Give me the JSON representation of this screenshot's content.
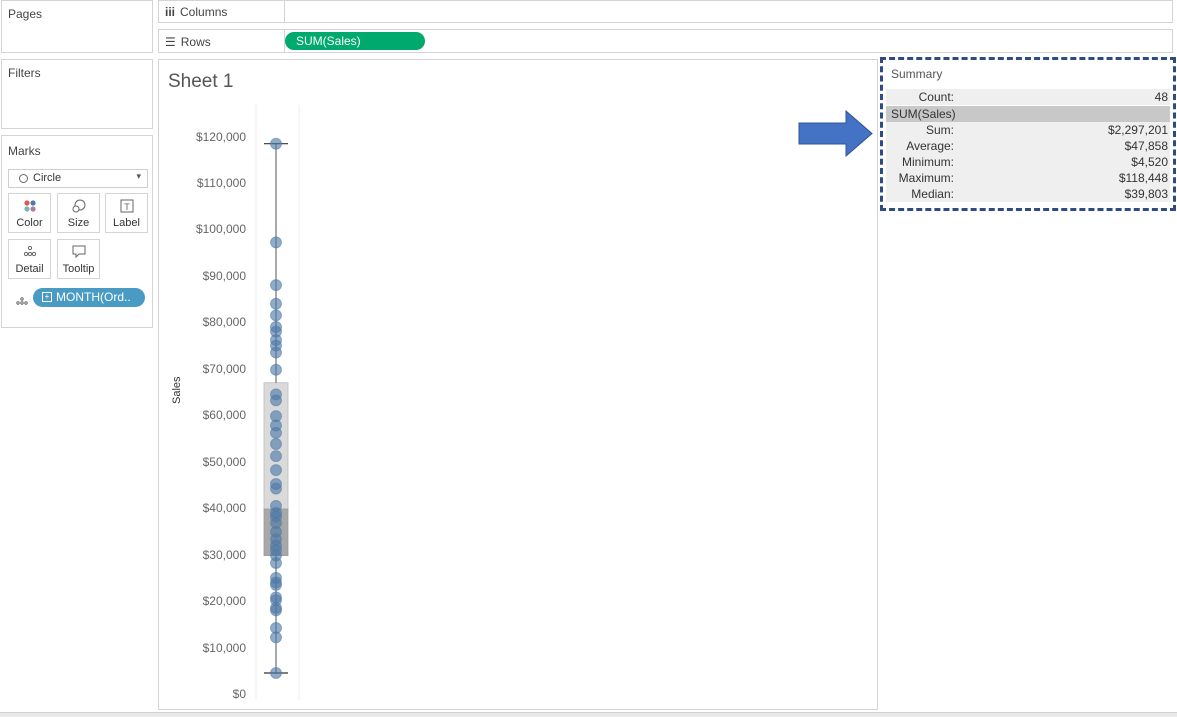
{
  "left_panel": {
    "pages_title": "Pages",
    "filters_title": "Filters",
    "marks_title": "Marks",
    "mark_type": "Circle",
    "buttons": [
      {
        "label": "Color",
        "icon": "color-icon"
      },
      {
        "label": "Size",
        "icon": "size-icon"
      },
      {
        "label": "Label",
        "icon": "label-icon"
      },
      {
        "label": "Detail",
        "icon": "detail-icon"
      },
      {
        "label": "Tooltip",
        "icon": "tooltip-icon"
      }
    ],
    "detail_pill": "MONTH(Ord.."
  },
  "shelves": {
    "columns_label": "Columns",
    "rows_label": "Rows",
    "rows_pill": "SUM(Sales)"
  },
  "sheet": {
    "title": "Sheet 1"
  },
  "chart_data": {
    "type": "scatter",
    "title": "Sheet 1",
    "ylabel": "Sales",
    "xlabel": "",
    "ylim": [
      0,
      125000
    ],
    "yticks": [
      "$0",
      "$10,000",
      "$20,000",
      "$30,000",
      "$40,000",
      "$50,000",
      "$60,000",
      "$70,000",
      "$80,000",
      "$90,000",
      "$100,000",
      "$110,000",
      "$120,000"
    ],
    "ytick_values": [
      0,
      10000,
      20000,
      30000,
      40000,
      50000,
      60000,
      70000,
      80000,
      90000,
      100000,
      110000,
      120000
    ],
    "box_plot": {
      "min": 4520,
      "q1": 29800,
      "median": 39803,
      "q3": 67000,
      "max": 118448
    },
    "values": [
      118448,
      97200,
      88000,
      84000,
      81500,
      79000,
      78000,
      76200,
      75000,
      73500,
      69800,
      64500,
      63200,
      59800,
      57800,
      56200,
      53800,
      51200,
      48200,
      45200,
      44200,
      40500,
      39000,
      38200,
      36800,
      34900,
      33300,
      32000,
      31000,
      29800,
      28200,
      25000,
      24000,
      23500,
      20800,
      20200,
      18500,
      18000,
      14200,
      12200,
      4520
    ],
    "grid": false,
    "color": "#4e79a7",
    "box_light": "#dadada",
    "box_dark": "#a8a8a8"
  },
  "summary": {
    "title": "Summary",
    "count_label": "Count:",
    "count_value": "48",
    "section": "SUM(Sales)",
    "rows": [
      {
        "label": "Sum:",
        "value": "$2,297,201"
      },
      {
        "label": "Average:",
        "value": "$47,858"
      },
      {
        "label": "Minimum:",
        "value": "$4,520"
      },
      {
        "label": "Maximum:",
        "value": "$118,448"
      },
      {
        "label": "Median:",
        "value": "$39,803"
      }
    ]
  },
  "annotation": {
    "arrow_color": "#4472c4",
    "border_color": "#2e4b86"
  }
}
